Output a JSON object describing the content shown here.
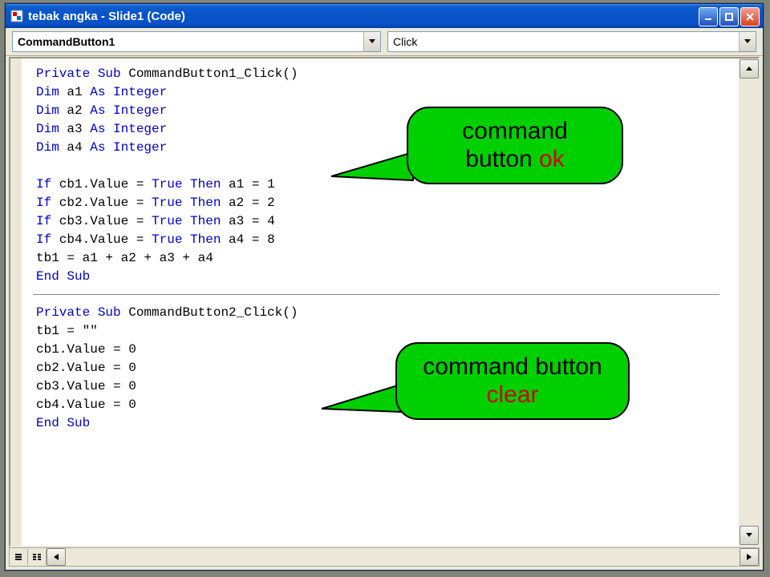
{
  "window": {
    "title": "tebak angka - Slide1 (Code)"
  },
  "dropdowns": {
    "object": "CommandButton1",
    "event": "Click"
  },
  "code": {
    "sub1": {
      "line1_pre": "Private Sub",
      "line1_name": " CommandButton1_Click()",
      "dim1_pre": "Dim",
      "dim1_mid": " a1 ",
      "dim1_kw2": "As Integer",
      "dim2_pre": "Dim",
      "dim2_mid": " a2 ",
      "dim2_kw2": "As Integer",
      "dim3_pre": "Dim",
      "dim3_mid": " a3 ",
      "dim3_kw2": "As Integer",
      "dim4_pre": "Dim",
      "dim4_mid": " a4 ",
      "dim4_kw2": "As Integer",
      "if1_kw1": "If",
      "if1_mid1": " cb1.Value = ",
      "if1_kw2": "True Then",
      "if1_mid2": " a1 = 1",
      "if2_kw1": "If",
      "if2_mid1": " cb2.Value = ",
      "if2_kw2": "True Then",
      "if2_mid2": " a2 = 2",
      "if3_kw1": "If",
      "if3_mid1": " cb3.Value = ",
      "if3_kw2": "True Then",
      "if3_mid2": " a3 = 4",
      "if4_kw1": "If",
      "if4_mid1": " cb4.Value = ",
      "if4_kw2": "True Then",
      "if4_mid2": " a4 = 8",
      "sum": "tb1 = a1 + a2 + a3 + a4",
      "end": "End Sub"
    },
    "sub2": {
      "line1_pre": "Private Sub",
      "line1_name": " CommandButton2_Click()",
      "l2": "tb1 = \"\"",
      "l3": "cb1.Value = 0",
      "l4": "cb2.Value = 0",
      "l5": "cb3.Value = 0",
      "l6": "cb4.Value = 0",
      "end": "End Sub"
    }
  },
  "callouts": {
    "c1_text": "command button ",
    "c1_red": "ok",
    "c2_text": "command button ",
    "c2_red": "clear"
  }
}
